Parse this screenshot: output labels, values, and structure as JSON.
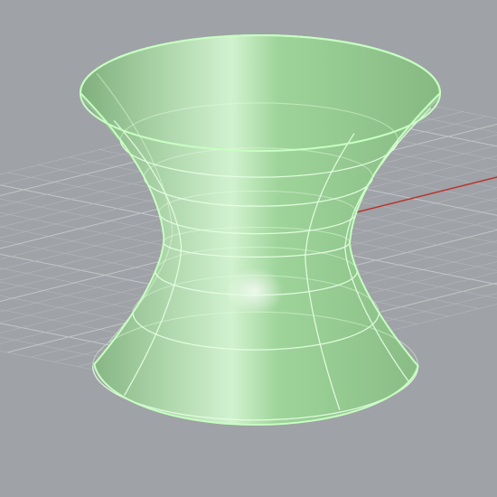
{
  "viewport": {
    "background_color": "#9fa2a6",
    "grid_visible": true,
    "grid_color": "#b4b7bb",
    "grid_major_color": "#c4c7ca",
    "x_axis_color": "#b8322a",
    "y_axis_color": "#2a2a2a"
  },
  "object": {
    "type": "hyperboloid-of-one-sheet",
    "surface_color": "#9ed49a",
    "surface_shadow_color": "#7fb07c",
    "surface_highlight_color": "#d2f2cf",
    "isocurve_color": "#e6ffe3",
    "selected": true,
    "highlight_edge_color": "#c7ffc2"
  }
}
